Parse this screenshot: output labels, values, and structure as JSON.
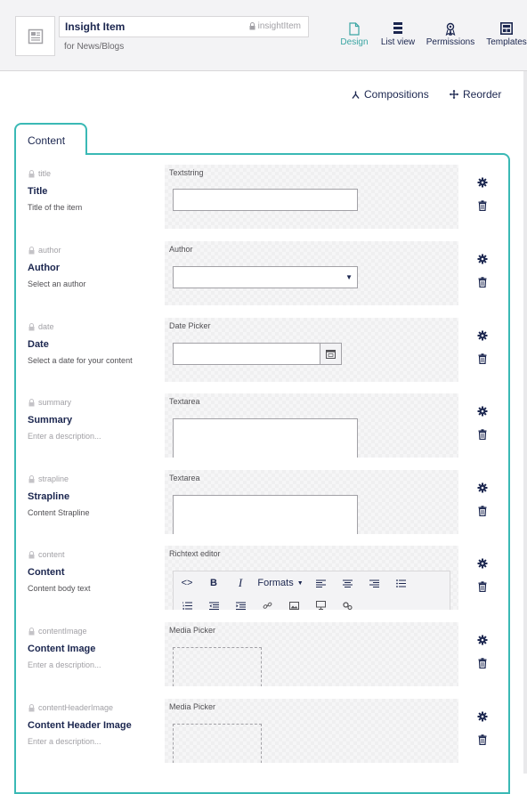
{
  "header": {
    "name": "Insight Item",
    "alias": "insightItem",
    "description": "for News/Blogs",
    "nav": [
      {
        "label": "Design",
        "icon": "document-icon",
        "active": true
      },
      {
        "label": "List view",
        "icon": "list-view-icon",
        "active": false
      },
      {
        "label": "Permissions",
        "icon": "permissions-icon",
        "active": false
      },
      {
        "label": "Templates",
        "icon": "templates-icon",
        "active": false
      }
    ]
  },
  "toolbar": {
    "compositions_label": "Compositions",
    "reorder_label": "Reorder"
  },
  "tab": {
    "label": "Content"
  },
  "properties": [
    {
      "alias": "title",
      "label": "Title",
      "description": "Title of the item",
      "editor": "Textstring"
    },
    {
      "alias": "author",
      "label": "Author",
      "description": "Select an author",
      "editor": "Author"
    },
    {
      "alias": "date",
      "label": "Date",
      "description": "Select a date for your content",
      "editor": "Date Picker"
    },
    {
      "alias": "summary",
      "label": "Summary",
      "description": "Enter a description...",
      "editor": "Textarea"
    },
    {
      "alias": "strapline",
      "label": "Strapline",
      "description": "Content Strapline",
      "editor": "Textarea"
    },
    {
      "alias": "content",
      "label": "Content",
      "description": "Content body text",
      "editor": "Richtext editor"
    },
    {
      "alias": "contentImage",
      "label": "Content Image",
      "description": "Enter a description...",
      "editor": "Media Picker"
    },
    {
      "alias": "contentHeaderImage",
      "label": "Content Header Image",
      "description": "Enter a description...",
      "editor": "Media Picker"
    }
  ],
  "rte": {
    "formats_label": "Formats"
  },
  "colors": {
    "accent": "#3ab9b5",
    "text": "#1b264f",
    "muted": "#a2a1a6"
  }
}
